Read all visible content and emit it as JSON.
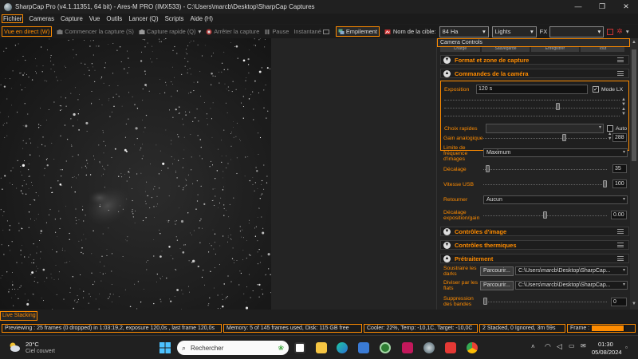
{
  "window": {
    "title": "SharpCap Pro (v4.1.11351, 64 bit) - Ares-M PRO (IMX533) - C:\\Users\\marcb\\Desktop\\SharpCap Captures",
    "minimize": "—",
    "maximize": "❐",
    "close": "✕"
  },
  "menu": [
    {
      "label": "Fichier",
      "active": true
    },
    {
      "label": "Cameras"
    },
    {
      "label": "Capture"
    },
    {
      "label": "Vue"
    },
    {
      "label": "Outils"
    },
    {
      "label": "Lancer (Q)"
    },
    {
      "label": "Scripts"
    },
    {
      "label": "Aide (H)"
    }
  ],
  "toolbar": {
    "live_view": "Vue en direct (W)",
    "start_capture": "Commencer la capture (S)",
    "quick_capture": "Capture rapide (Q)",
    "stop_capture": "Arrêter la capture",
    "pause": "Pause",
    "snapshot": "Instantané",
    "stacking": "Empilement",
    "target_label": "Nom de la cible:",
    "target_value": "84 Ha",
    "frame_type": "Lights",
    "fx_label": "FX",
    "fx_value": ""
  },
  "panel": {
    "title": "Camera Controls",
    "tabs_stub": [
      "Charge",
      "Sauvegarde",
      "Enregistrer",
      "Tout"
    ],
    "sections": {
      "format": "Format et zone de capture",
      "camera_controls": "Commandes de la caméra",
      "image_controls": "Contrôles d'image",
      "thermal_controls": "Contrôles thermiques",
      "preprocessing": "Prétraitement"
    },
    "exposure": {
      "label": "Exposition",
      "value": "120 s",
      "lx_label": "Mode LX",
      "lx_checked": "✓"
    },
    "quick_choices": {
      "label": "Choix rapides",
      "auto_label": "Auto"
    },
    "gain": {
      "label": "Gain analogique",
      "value": "288",
      "level": 0.66
    },
    "frame_rate": {
      "label": "Limite de fréquence d'images",
      "value": "Maximum"
    },
    "offset": {
      "label": "Décalage",
      "value": "35",
      "level": 0.02
    },
    "usb_speed": {
      "label": "Vitesse USB",
      "value": "100",
      "level": 1.0
    },
    "flip": {
      "label": "Retourner",
      "value": "Aucun"
    },
    "exp_gain_offset": {
      "label": "Décalage exposition/gain",
      "value": "0.00",
      "level": 0.5
    },
    "darks": {
      "label": "Soustraire les darks",
      "button": "Parcourir...",
      "path": "C:\\Users\\marcb\\Desktop\\SharpCap..."
    },
    "flats": {
      "label": "Diviser par les flats",
      "button": "Parcourir...",
      "path": "C:\\Users\\marcb\\Desktop\\SharpCap..."
    },
    "banding": {
      "label": "Suppression des bandes",
      "value": "0",
      "level": 0.0
    }
  },
  "live_stacking": "Live Stacking",
  "status": {
    "preview": "Previewing : 25 frames (0 dropped) in 1:03:19,2, exposure 120,0s , last frame 120,0s",
    "memory": "Memory: 5 of 145 frames used, Disk: 115 GB free",
    "cooler": "Cooler: 22%, Temp: -10,1C, Target: -10,0C",
    "stacking": "2 Stacked, 0 Ignored, 3m 59s",
    "frame_label": "Frame :",
    "frame_progress": 0.95
  },
  "taskbar": {
    "temp": "20°C",
    "weather": "Ciel couvert",
    "search_placeholder": "Rechercher",
    "time": "01:30",
    "date": "05/08/2024"
  },
  "colors": {
    "accent": "#ff8c00",
    "bg": "#1e1e1e"
  }
}
